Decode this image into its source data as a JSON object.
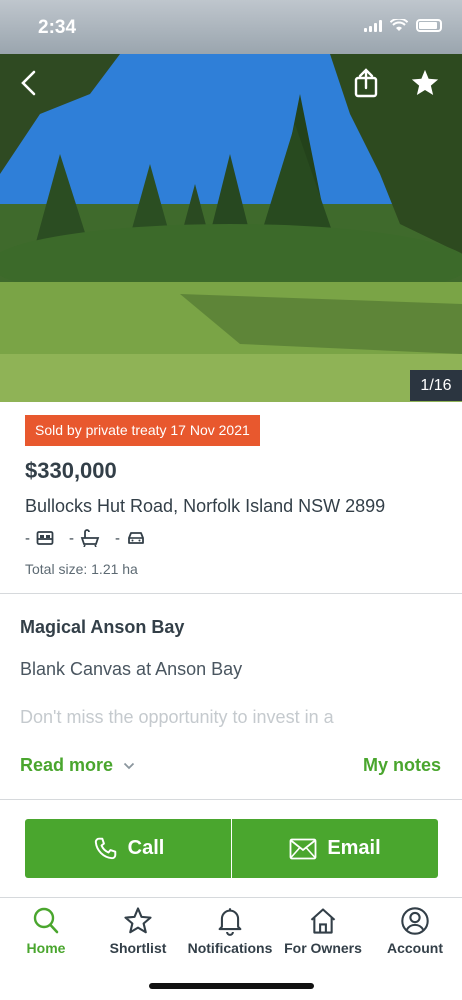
{
  "status_bar": {
    "time": "2:34"
  },
  "gallery": {
    "counter": "1/16"
  },
  "listing": {
    "badge": "Sold by private treaty 17 Nov 2021",
    "price": "$330,000",
    "address": "Bullocks Hut Road, Norfolk Island NSW 2899",
    "bedrooms": "-",
    "bathrooms": "-",
    "parking": "-",
    "total_size": "Total size: 1.21 ha"
  },
  "description": {
    "headline": "Magical Anson Bay",
    "subheading": "Blank Canvas at Anson Bay",
    "preview": "Don't miss the opportunity to invest in a",
    "read_more": "Read more",
    "my_notes": "My notes"
  },
  "actions": {
    "call": "Call",
    "email": "Email"
  },
  "tabs": [
    {
      "label": "Home",
      "icon": "search-icon",
      "active": true
    },
    {
      "label": "Shortlist",
      "icon": "star-icon",
      "active": false
    },
    {
      "label": "Notifications",
      "icon": "bell-icon",
      "active": false
    },
    {
      "label": "For Owners",
      "icon": "house-icon",
      "active": false
    },
    {
      "label": "Account",
      "icon": "user-icon",
      "active": false
    }
  ],
  "colors": {
    "brand_green": "#4aa62e",
    "badge_orange": "#e8582e",
    "text_dark": "#333f48"
  }
}
